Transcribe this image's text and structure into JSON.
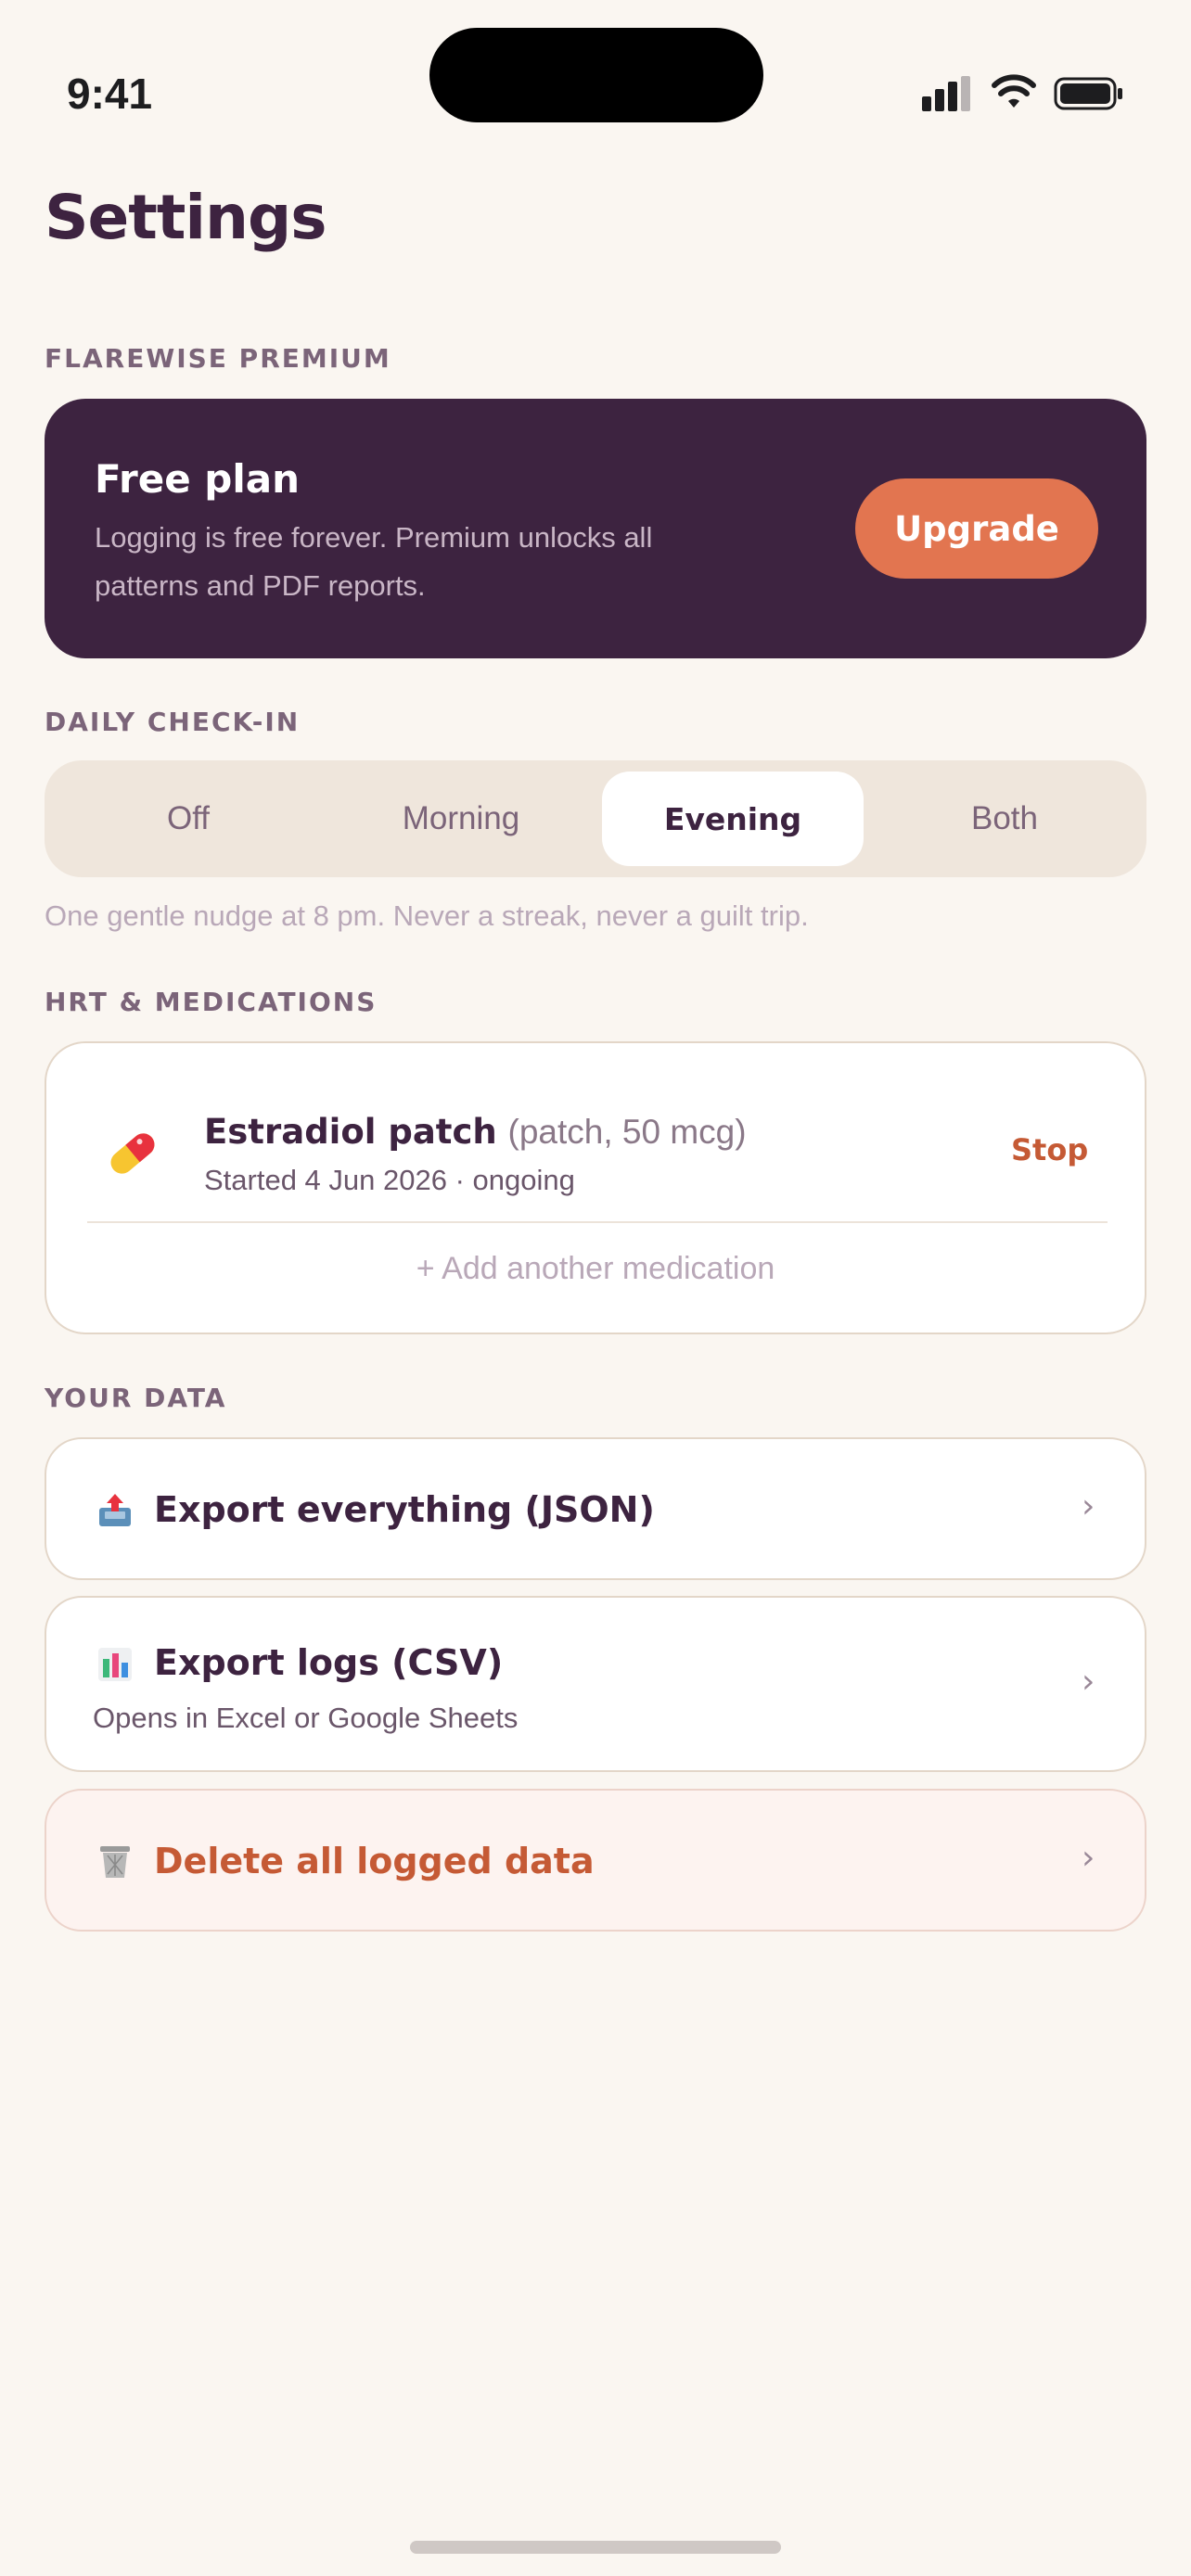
{
  "status_bar": {
    "time": "9:41"
  },
  "page": {
    "title": "Settings"
  },
  "premium": {
    "section_label": "FLAREWISE PREMIUM",
    "title": "Free plan",
    "description": "Logging is free forever. Premium unlocks all patterns and PDF reports.",
    "upgrade_label": "Upgrade"
  },
  "daily_checkin": {
    "section_label": "DAILY CHECK-IN",
    "options": [
      "Off",
      "Morning",
      "Evening",
      "Both"
    ],
    "selected": "Evening",
    "hint": "One gentle nudge at 8 pm. Never a streak, never a guilt trip."
  },
  "medications": {
    "section_label": "HRT & MEDICATIONS",
    "items": [
      {
        "name": "Estradiol patch",
        "detail": "(patch, 50 mcg)",
        "started": "Started 4 Jun 2026 · ongoing",
        "stop_label": "Stop",
        "icon": "pill-icon"
      }
    ],
    "add_label": "+ Add another medication"
  },
  "your_data": {
    "section_label": "YOUR DATA",
    "rows": [
      {
        "title": "Export everything (JSON)",
        "icon": "outbox-tray-icon"
      },
      {
        "title": "Export logs (CSV)",
        "subtitle": "Opens in Excel or Google Sheets",
        "icon": "bar-chart-icon"
      },
      {
        "title": "Delete all logged data",
        "icon": "wastebasket-icon"
      }
    ],
    "chevron": "›"
  },
  "colors": {
    "background": "#faf6f1",
    "plum": "#3d2340",
    "accent_orange": "#e27550",
    "danger": "#c55a35"
  }
}
